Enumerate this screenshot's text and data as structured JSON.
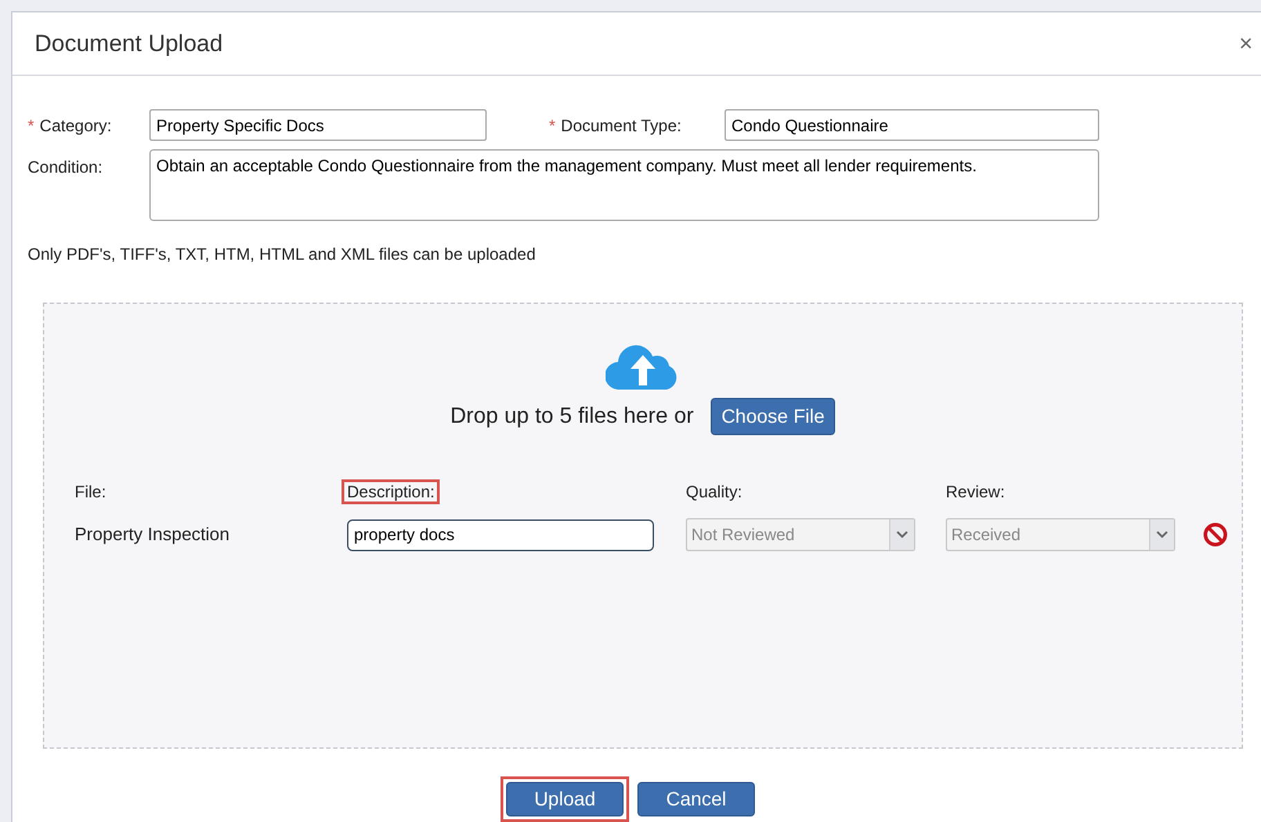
{
  "dialog": {
    "title": "Document Upload",
    "close": "×"
  },
  "fields": {
    "category": {
      "required_mark": "*",
      "label": "Category:",
      "value": "Property Specific Docs"
    },
    "document_type": {
      "required_mark": "*",
      "label": "Document Type:",
      "value": "Condo Questionnaire"
    },
    "condition": {
      "label": "Condition:",
      "value": "Obtain an acceptable Condo Questionnaire from the management company. Must meet all lender requirements."
    }
  },
  "note": "Only PDF's, TIFF's, TXT, HTM, HTML and XML files can be uploaded",
  "dropzone": {
    "prompt": "Drop up to 5 files here or",
    "button": "Choose File"
  },
  "files_table": {
    "columns": [
      {
        "label": "File:",
        "highlighted": false
      },
      {
        "label": "Description:",
        "highlighted": true
      },
      {
        "label": "Quality:",
        "highlighted": false
      },
      {
        "label": "Review:",
        "highlighted": false
      }
    ],
    "rows": [
      {
        "file": "Property Inspection",
        "description": "property docs",
        "quality": {
          "value": "Not Reviewed",
          "disabled": true
        },
        "review": {
          "value": "Received",
          "disabled": true
        }
      }
    ]
  },
  "buttons": [
    {
      "label": "Upload",
      "kind": "primary",
      "highlighted": true
    },
    {
      "label": "Cancel",
      "kind": "primary",
      "highlighted": false
    }
  ]
}
